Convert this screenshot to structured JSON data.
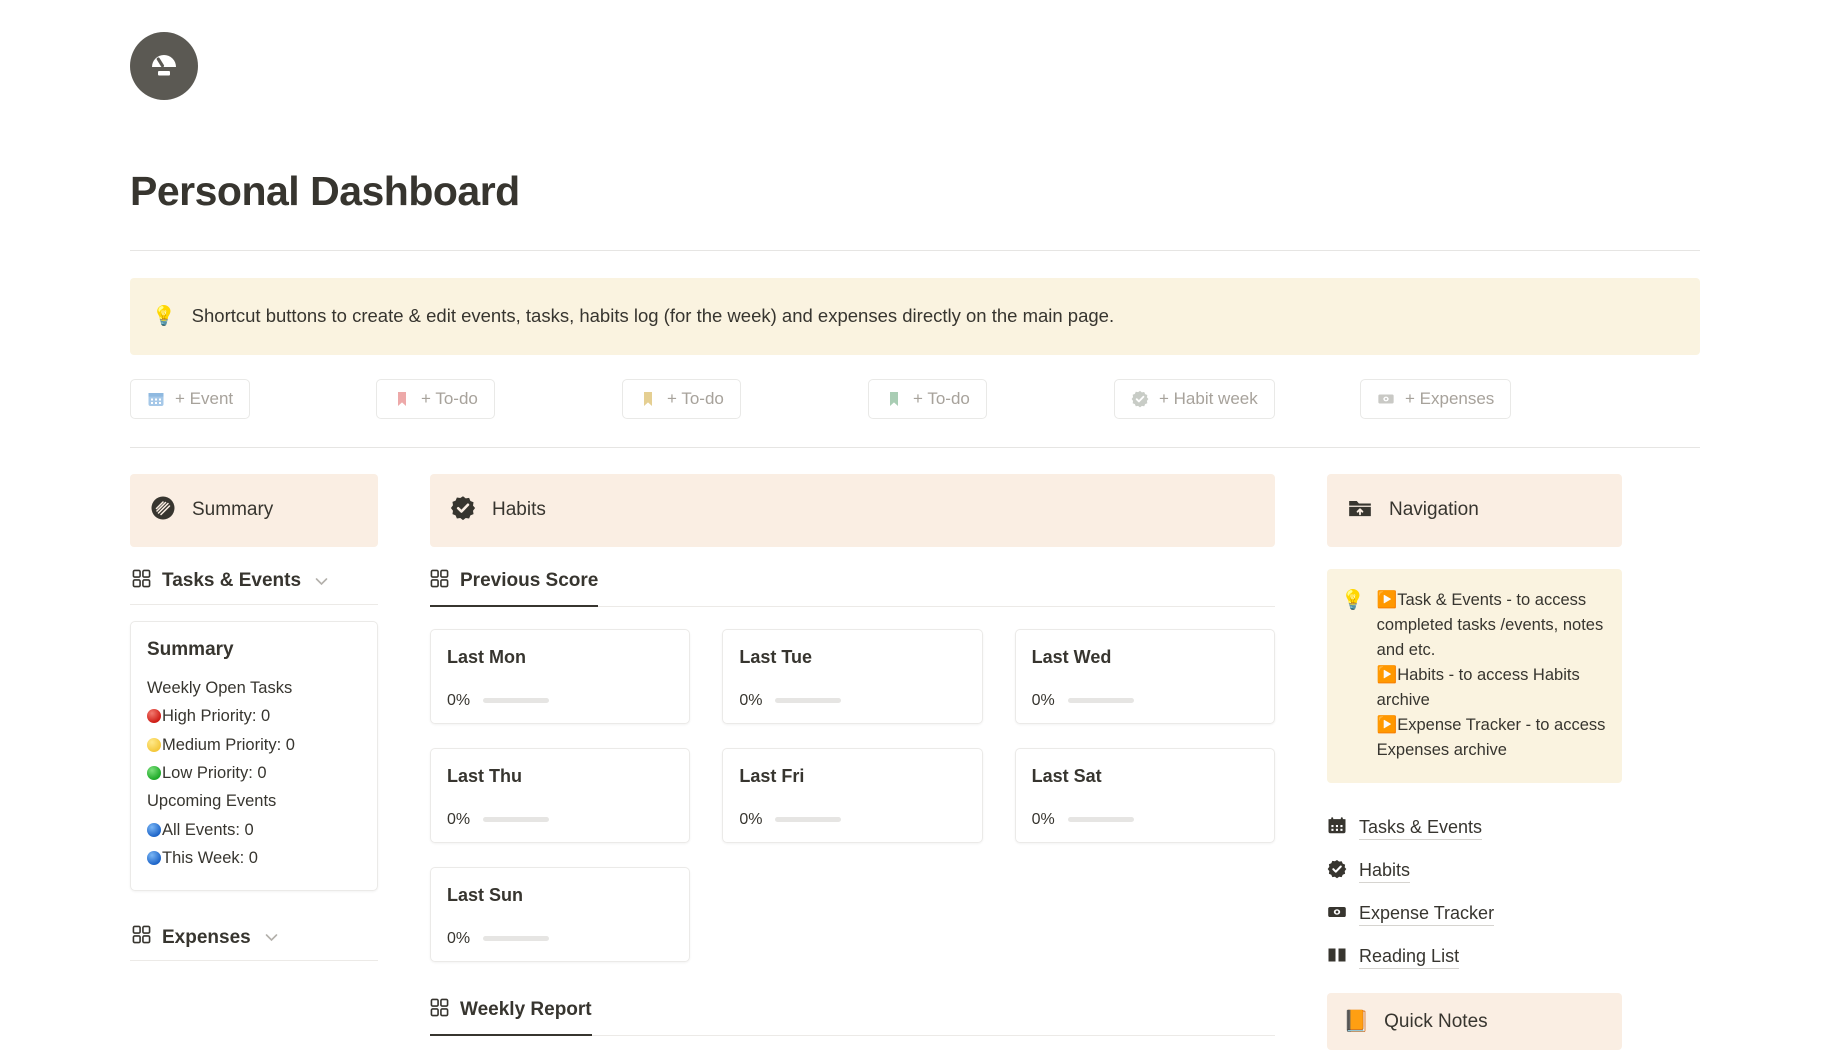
{
  "header": {
    "logo_icon": "gauge-circle-icon",
    "title": "Personal Dashboard"
  },
  "callout": {
    "icon": "lightbulb-icon",
    "text": "Shortcut buttons to create & edit events, tasks, habits log (for the week) and expenses directly on the main page."
  },
  "shortcuts": [
    {
      "icon": "calendar-icon",
      "icon_color": "#a6c8e8",
      "label": "+ Event"
    },
    {
      "icon": "bookmark-icon",
      "icon_color": "#eda9a9",
      "label": "+ To-do"
    },
    {
      "icon": "bookmark-icon",
      "icon_color": "#e5cf92",
      "label": "+ To-do"
    },
    {
      "icon": "bookmark-icon",
      "icon_color": "#a9cdb4",
      "label": "+ To-do"
    },
    {
      "icon": "badge-check-icon",
      "icon_color": "#c8ccc6",
      "label": "+ Habit week"
    },
    {
      "icon": "banknote-icon",
      "icon_color": "#c9c9c5",
      "label": "+ Expenses"
    }
  ],
  "left": {
    "section_head": {
      "icon": "summary-circle-icon",
      "title": "Summary"
    },
    "tasks_db": {
      "icon": "grid-icon",
      "label": "Tasks & Events",
      "chevron": "⌄"
    },
    "summary_card": {
      "title": "Summary",
      "group1_label": "Weekly Open Tasks",
      "group1_rows": [
        {
          "dot": "red",
          "text": "High Priority: 0"
        },
        {
          "dot": "yellow",
          "text": "Medium Priority: 0"
        },
        {
          "dot": "green",
          "text": "Low Priority: 0"
        }
      ],
      "group2_label": "Upcoming Events",
      "group2_rows": [
        {
          "dot": "blue",
          "text": "All Events: 0"
        },
        {
          "dot": "blue",
          "text": "This Week: 0"
        }
      ]
    },
    "expenses_db": {
      "icon": "grid-icon",
      "label": "Expenses",
      "chevron": "⌄"
    }
  },
  "middle": {
    "section_head": {
      "icon": "badge-check-icon",
      "title": "Habits"
    },
    "tab_previous_score": {
      "icon": "grid-icon",
      "label": "Previous Score"
    },
    "tab_weekly_report": {
      "icon": "grid-icon",
      "label": "Weekly Report"
    },
    "habit_cards": [
      {
        "day": "Last Mon",
        "percent_label": "0%",
        "percent": 0
      },
      {
        "day": "Last Tue",
        "percent_label": "0%",
        "percent": 0
      },
      {
        "day": "Last Wed",
        "percent_label": "0%",
        "percent": 0
      },
      {
        "day": "Last Thu",
        "percent_label": "0%",
        "percent": 0
      },
      {
        "day": "Last Fri",
        "percent_label": "0%",
        "percent": 0
      },
      {
        "day": "Last Sat",
        "percent_label": "0%",
        "percent": 0
      },
      {
        "day": "Last Sun",
        "percent_label": "0%",
        "percent": 0
      }
    ]
  },
  "right": {
    "section_head": {
      "icon": "folder-upload-icon",
      "title": "Navigation"
    },
    "callout": {
      "icon": "lightbulb-icon",
      "lines": [
        "▶️Task & Events - to access completed tasks /events, notes and etc.",
        "▶️Habits - to access Habits archive",
        "▶️Expense Tracker - to access Expenses archive"
      ]
    },
    "links": [
      {
        "icon": "calendar-icon",
        "label": "Tasks & Events"
      },
      {
        "icon": "badge-check-icon",
        "label": "Habits"
      },
      {
        "icon": "banknote-icon",
        "label": "Expense Tracker"
      },
      {
        "icon": "open-book-icon",
        "label": "Reading List"
      }
    ],
    "quick_notes": {
      "icon": "notebook-emoji",
      "label": "Quick Notes"
    }
  },
  "colors": {
    "section_head_bg": "#faeee3",
    "callout_bg": "#faf3e0",
    "text": "#37352f",
    "muted": "#a7a29b"
  }
}
